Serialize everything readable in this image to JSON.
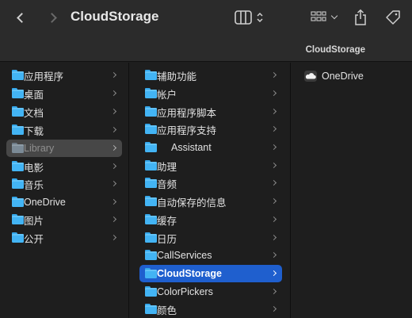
{
  "window": {
    "title": "CloudStorage",
    "path_label": "CloudStorage"
  },
  "toolbar": {
    "back_icon": "chevron-left-icon",
    "forward_icon": "chevron-right-icon",
    "view_icon": "column-view-icon",
    "group_icon": "group-icon",
    "share_icon": "share-icon",
    "tag_icon": "tag-icon"
  },
  "sidebar": {
    "items": [
      {
        "label": "应用程序",
        "icon": "folder-icon"
      },
      {
        "label": "桌面",
        "icon": "folder-icon"
      },
      {
        "label": "文档",
        "icon": "folder-icon"
      },
      {
        "label": "下载",
        "icon": "folder-icon"
      },
      {
        "label": "Library",
        "icon": "folder-icon",
        "state": "dimmed-selected"
      },
      {
        "label": "电影",
        "icon": "folder-icon"
      },
      {
        "label": "音乐",
        "icon": "folder-icon"
      },
      {
        "label": "OneDrive",
        "icon": "folder-icon"
      },
      {
        "label": "图片",
        "icon": "folder-icon"
      },
      {
        "label": "公开",
        "icon": "folder-icon"
      }
    ]
  },
  "library_column": {
    "items": [
      {
        "label": "辅助功能"
      },
      {
        "label": "帐户"
      },
      {
        "label": "应用程序脚本"
      },
      {
        "label": "应用程序支持"
      },
      {
        "label": "Assistant"
      },
      {
        "label": "助理"
      },
      {
        "label": "音频"
      },
      {
        "label": "自动保存的信息"
      },
      {
        "label": "缓存"
      },
      {
        "label": "日历"
      },
      {
        "label": "CallServices"
      },
      {
        "label": "CloudStorage",
        "state": "selected"
      },
      {
        "label": "ColorPickers"
      },
      {
        "label": "颜色"
      }
    ]
  },
  "cloudstorage_column": {
    "items": [
      {
        "label": "OneDrive",
        "icon": "onedrive-cloud-icon"
      }
    ]
  },
  "colors": {
    "accent": "#1f5fce",
    "folder": "#43b4f4",
    "background": "#1e1e1e",
    "toolbar": "#2b2b2b"
  }
}
